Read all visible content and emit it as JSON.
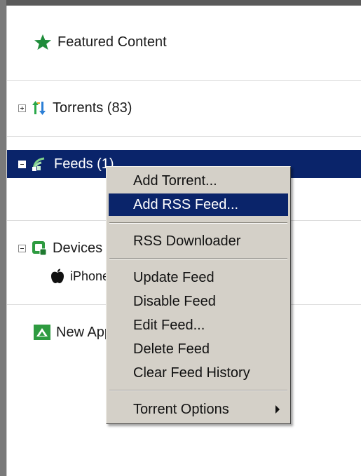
{
  "sidebar": {
    "featured": {
      "label": "Featured Content",
      "icon": "star-icon",
      "color": "#1e8c3a"
    },
    "torrents": {
      "label": "Torrents (83)",
      "icon": "transfer-arrows-icon"
    },
    "feeds": {
      "label": "Feeds (1)",
      "icon": "rss-feed-icon"
    },
    "devices": {
      "label": "Devices",
      "icon": "device-icon"
    },
    "iphone": {
      "label": "iPhone",
      "icon": "apple-icon"
    },
    "new_app": {
      "label": "New Apps",
      "icon": "app-icon"
    }
  },
  "context_menu": {
    "items": [
      {
        "label": "Add Torrent..."
      },
      {
        "label": "Add RSS Feed..."
      },
      {
        "label": "RSS Downloader"
      },
      {
        "label": "Update Feed"
      },
      {
        "label": "Disable Feed"
      },
      {
        "label": "Edit Feed..."
      },
      {
        "label": "Delete Feed"
      },
      {
        "label": "Clear Feed History"
      },
      {
        "label": "Torrent Options"
      }
    ]
  },
  "colors": {
    "selection": "#0a246a",
    "menu_bg": "#d4d0c8"
  }
}
